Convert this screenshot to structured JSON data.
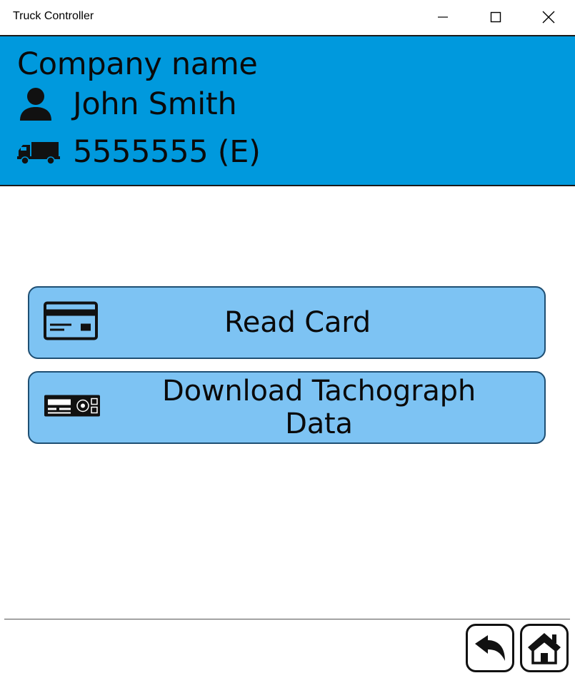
{
  "window": {
    "title": "Truck Controller",
    "controls": {
      "minimize": "minimize-icon",
      "maximize": "maximize-icon",
      "close": "close-icon"
    }
  },
  "header": {
    "company": "Company name",
    "driver_name": "John Smith",
    "vehicle": "5555555 (E)",
    "background_color": "#0099dd"
  },
  "actions": {
    "read_card": {
      "label": "Read Card",
      "icon": "card-icon"
    },
    "download_tachograph": {
      "label": "Download Tachograph Data",
      "icon": "tachograph-icon"
    },
    "button_color": "#7dc3f3"
  },
  "footer": {
    "back": {
      "icon": "back-arrow-icon"
    },
    "home": {
      "icon": "home-icon"
    }
  }
}
